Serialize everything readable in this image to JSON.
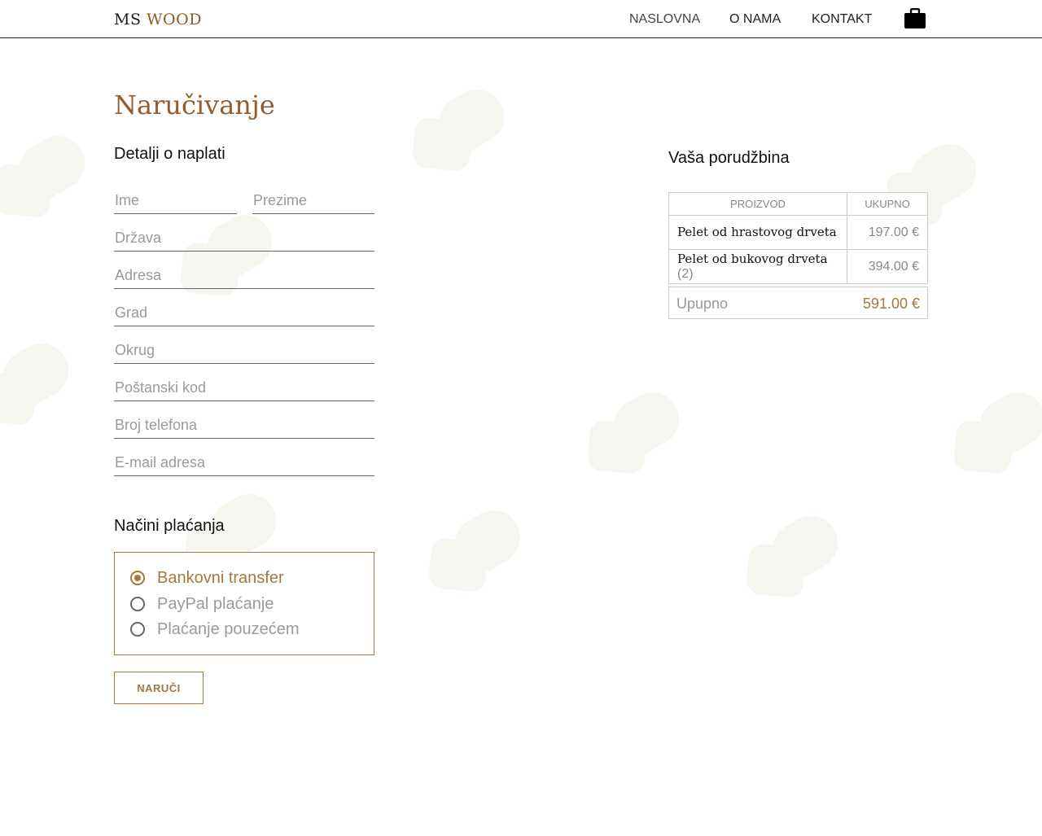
{
  "header": {
    "logo_part1": "MS",
    "logo_part2": "WOOD",
    "nav": [
      "NASLOVNA",
      "O NAMA",
      "KONTAKT"
    ],
    "cart_icon": "shopping-bag-icon"
  },
  "page_title": "Naručivanje",
  "billing": {
    "title": "Detalji o naplati",
    "fields": {
      "first_name": "Ime",
      "last_name": "Prezime",
      "country": "Država",
      "address": "Adresa",
      "city": "Grad",
      "district": "Okrug",
      "postal_code": "Poštanski kod",
      "phone": "Broj telefona",
      "email": "E-mail adresa"
    }
  },
  "order": {
    "title": "Vaša porudžbina",
    "col_product": "PROIZVOD",
    "col_total": "UKUPNO",
    "items": [
      {
        "name": "Pelet od hrastovog drveta",
        "qty": "",
        "price": "197.00 €"
      },
      {
        "name": "Pelet od bukovog drveta",
        "qty": "(2)",
        "price": "394.00 €"
      }
    ],
    "total_label": "Upupno",
    "total_value": "591.00 €"
  },
  "payment": {
    "title": "Načini plaćanja",
    "options": [
      "Bankovni transfer",
      "PayPal plaćanje",
      "Plaćanje pouzećem"
    ],
    "selected": "Bankovni transfer"
  },
  "submit_label": "NARUČI",
  "colors": {
    "accent": "#a4783c",
    "title_brown": "#955c2a",
    "muted": "#9a9a9a"
  }
}
